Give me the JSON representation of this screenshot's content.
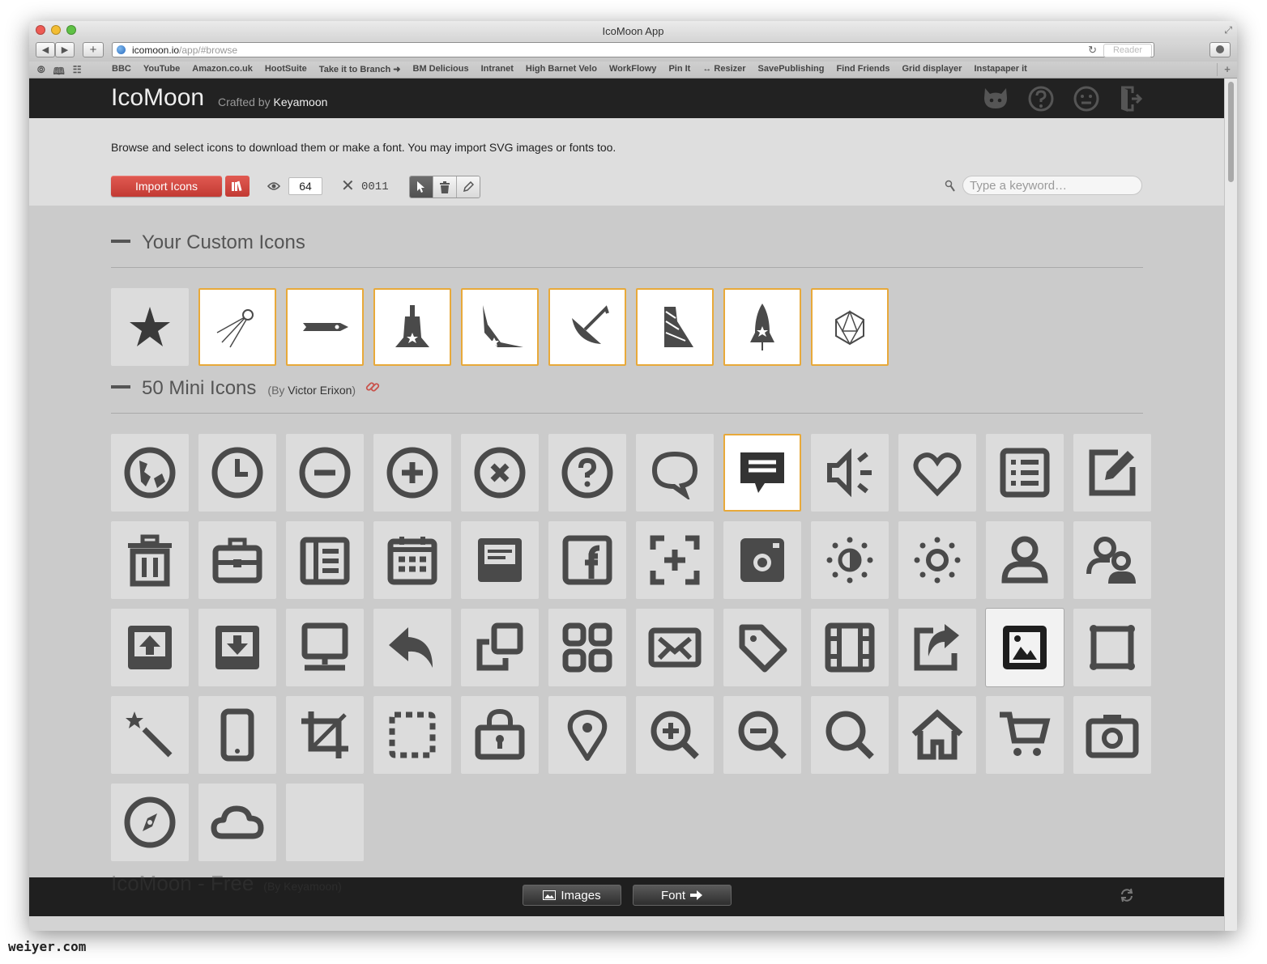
{
  "window": {
    "title": "IcoMoon App"
  },
  "browser": {
    "url_host": "icomoon.io",
    "url_path": "/app/#browse",
    "reader_label": "Reader",
    "bookmarks": [
      "BBC",
      "YouTube",
      "Amazon.co.uk",
      "HootSuite",
      "Take it to Branch ➜",
      "BM Delicious",
      "Intranet",
      "High Barnet Velo",
      "WorkFlowy",
      "Pin It",
      "↔ Resizer",
      "SavePublishing",
      "Find Friends",
      "Grid displayer",
      "Instapaper it"
    ]
  },
  "header": {
    "logo": "IcoMoon",
    "crafted_prefix": "Crafted by",
    "crafted_author": "Keyamoon"
  },
  "toolbar": {
    "intro": "Browse and select icons to download them or make a font. You may import SVG images or fonts too.",
    "import_label": "Import Icons",
    "size_value": "64",
    "code_label": "0011",
    "search_placeholder": "Type a keyword…"
  },
  "sections": {
    "custom": {
      "title": "Your Custom Icons"
    },
    "mini": {
      "title": "50 Mini Icons",
      "by_prefix": "(By",
      "author": "Victor Erixon",
      "by_suffix": ")"
    },
    "free": {
      "title": "IcoMoon - Free",
      "by": "(By Keyamoon)"
    }
  },
  "custom_icons": [
    {
      "name": "star-shape-icon",
      "selected": false
    },
    {
      "name": "satellite-icon",
      "selected": true
    },
    {
      "name": "missile-icon",
      "selected": true
    },
    {
      "name": "launch-tower-icon",
      "selected": true
    },
    {
      "name": "wing-icon",
      "selected": true
    },
    {
      "name": "dish-icon",
      "selected": true
    },
    {
      "name": "rocket-tower-icon",
      "selected": true
    },
    {
      "name": "rocket-icon",
      "selected": true
    },
    {
      "name": "polyhedron-icon",
      "selected": true
    }
  ],
  "mini_icons": [
    "globe-icon",
    "clock-icon",
    "minus-circle-icon",
    "plus-circle-icon",
    "close-circle-icon",
    "help-circle-icon",
    "speech-bubble-icon",
    "comment-icon",
    "volume-icon",
    "heart-icon",
    "list-icon",
    "edit-icon",
    "trash-icon",
    "briefcase-icon",
    "newspaper-icon",
    "calendar-icon",
    "inbox-icon",
    "facebook-icon",
    "focus-add-icon",
    "instagram-icon",
    "brightness-icon",
    "sun-icon",
    "user-icon",
    "users-icon",
    "upload-icon",
    "download-icon",
    "monitor-icon",
    "reply-icon",
    "copy-icon",
    "apps-icon",
    "mail-icon",
    "tag-icon",
    "film-icon",
    "share-icon",
    "image-icon",
    "frame-icon",
    "magic-wand-icon",
    "mobile-icon",
    "crop-icon",
    "selection-icon",
    "lock-icon",
    "location-pin-icon",
    "zoom-in-icon",
    "zoom-out-icon",
    "search-icon",
    "home-icon",
    "cart-icon",
    "camera-icon",
    "compass-icon",
    "cloud-icon",
    "empty-slot"
  ],
  "mini_selected": [
    "comment-icon"
  ],
  "mini_highlight": [
    "image-icon"
  ],
  "footer": {
    "images_label": "Images",
    "font_label": "Font"
  },
  "watermark": "weiyer.com",
  "colors": {
    "accent": "#c9463f",
    "select": "#e8a93a",
    "icon": "#4a4a4a",
    "header": "#222222"
  }
}
